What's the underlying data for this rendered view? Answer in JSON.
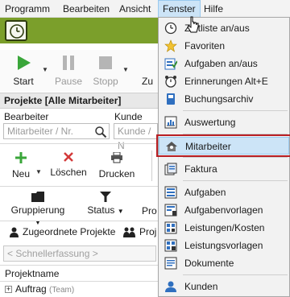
{
  "menubar": {
    "items": [
      {
        "label": "Programm"
      },
      {
        "label": "Bearbeiten"
      },
      {
        "label": "Ansicht"
      },
      {
        "label": "Fenster"
      },
      {
        "label": "Hilfe"
      }
    ]
  },
  "colors": {
    "timer_bar": "#7b9f2b",
    "start_green": "#3aa63a",
    "delete_red": "#d33a3a",
    "new_green": "#3aa63a",
    "highlight_outline": "#b81f24",
    "menu_highlight": "#cce4f7"
  },
  "toolbar": {
    "start": "Start",
    "pause": "Pause",
    "stopp": "Stopp",
    "zu_partial": "Zu"
  },
  "projects": {
    "title": "Projekte [Alle Mitarbeiter]",
    "bearbeiter_label": "Bearbeiter",
    "bearbeiter_placeholder": "Mitarbeiter / Nr.",
    "kunde_label": "Kunde",
    "kunde_placeholder": "Kunde / N"
  },
  "actions": {
    "neu": "Neu",
    "loeschen": "Löschen",
    "drucken": "Drucken"
  },
  "filters": {
    "gruppierung": "Gruppierung",
    "status": "Status",
    "pro_partial": "Pro"
  },
  "assign": {
    "zugeordnete": "Zugeordnete Projekte",
    "proj_partial": "Proj"
  },
  "quick_entry_placeholder": "< Schnellerfassung >",
  "tree": {
    "column": "Projektname",
    "row_label": "Auftrag",
    "row_tag": "(Team)"
  },
  "dropdown": {
    "items": [
      {
        "label": "Zeitliste an/aus",
        "icon": "clock-icon"
      },
      {
        "label": "Favoriten",
        "icon": "star-icon"
      },
      {
        "label": "Aufgaben an/aus",
        "icon": "tasks-icon"
      },
      {
        "label": "Erinnerungen Alt+E",
        "icon": "alarm-clock-icon"
      },
      {
        "label": "Buchungsarchiv",
        "icon": "archive-icon"
      },
      {
        "label": "Auswertung",
        "icon": "chart-icon"
      },
      {
        "label": "Mitarbeiter",
        "icon": "employees-icon"
      },
      {
        "label": "Faktura",
        "icon": "invoice-icon"
      },
      {
        "label": "Aufgaben",
        "icon": "task-list-icon"
      },
      {
        "label": "Aufgabenvorlagen",
        "icon": "task-template-icon"
      },
      {
        "label": "Leistungen/Kosten",
        "icon": "services-icon"
      },
      {
        "label": "Leistungsvorlagen",
        "icon": "services-template-icon"
      },
      {
        "label": "Dokumente",
        "icon": "documents-icon"
      },
      {
        "label": "Kunden",
        "icon": "customers-icon"
      }
    ]
  }
}
